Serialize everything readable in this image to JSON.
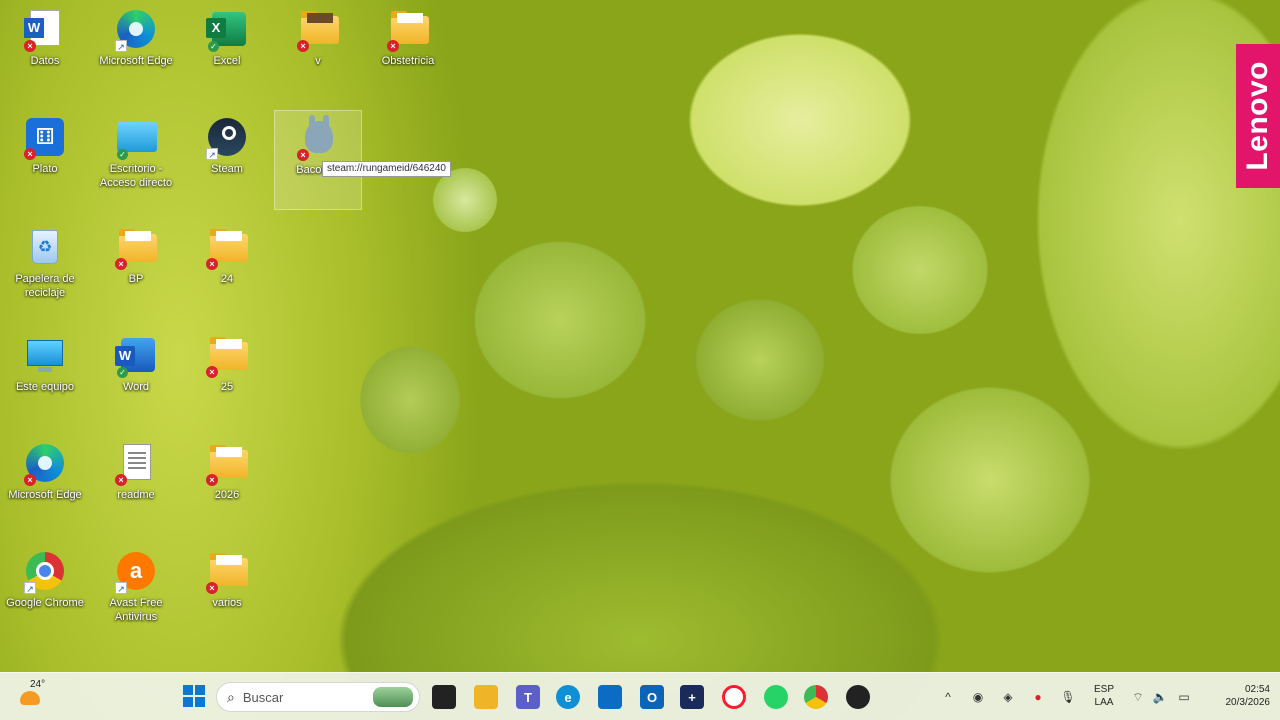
{
  "desktop": {
    "icons": [
      {
        "label": "Datos"
      },
      {
        "label": "Microsoft Edge"
      },
      {
        "label": "Excel"
      },
      {
        "label": "v"
      },
      {
        "label": "Obstetricia"
      },
      {
        "label": "Plato"
      },
      {
        "label": "Escritorio - Acceso directo"
      },
      {
        "label": "Steam"
      },
      {
        "label": "Bacon M"
      },
      {
        "label": "Papelera de reciclaje"
      },
      {
        "label": "BP"
      },
      {
        "label": "24"
      },
      {
        "label": "Este equipo"
      },
      {
        "label": "Word"
      },
      {
        "label": "25"
      },
      {
        "label": "Microsoft Edge"
      },
      {
        "label": "readme"
      },
      {
        "label": "2026"
      },
      {
        "label": "Google Chrome"
      },
      {
        "label": "Avast Free Antivirus"
      },
      {
        "label": "varios"
      }
    ],
    "tooltip": "steam://rungameid/646240",
    "brand": "Lenovo"
  },
  "taskbar": {
    "weather_temp": "24°",
    "search_placeholder": "Buscar",
    "language": "ESP",
    "layout": "LAA",
    "time": "02:54",
    "date": "20/3/2026"
  },
  "colors": {
    "lenovo": "#e2156b",
    "folder": "#f0b429",
    "error_badge": "#d9222a"
  }
}
